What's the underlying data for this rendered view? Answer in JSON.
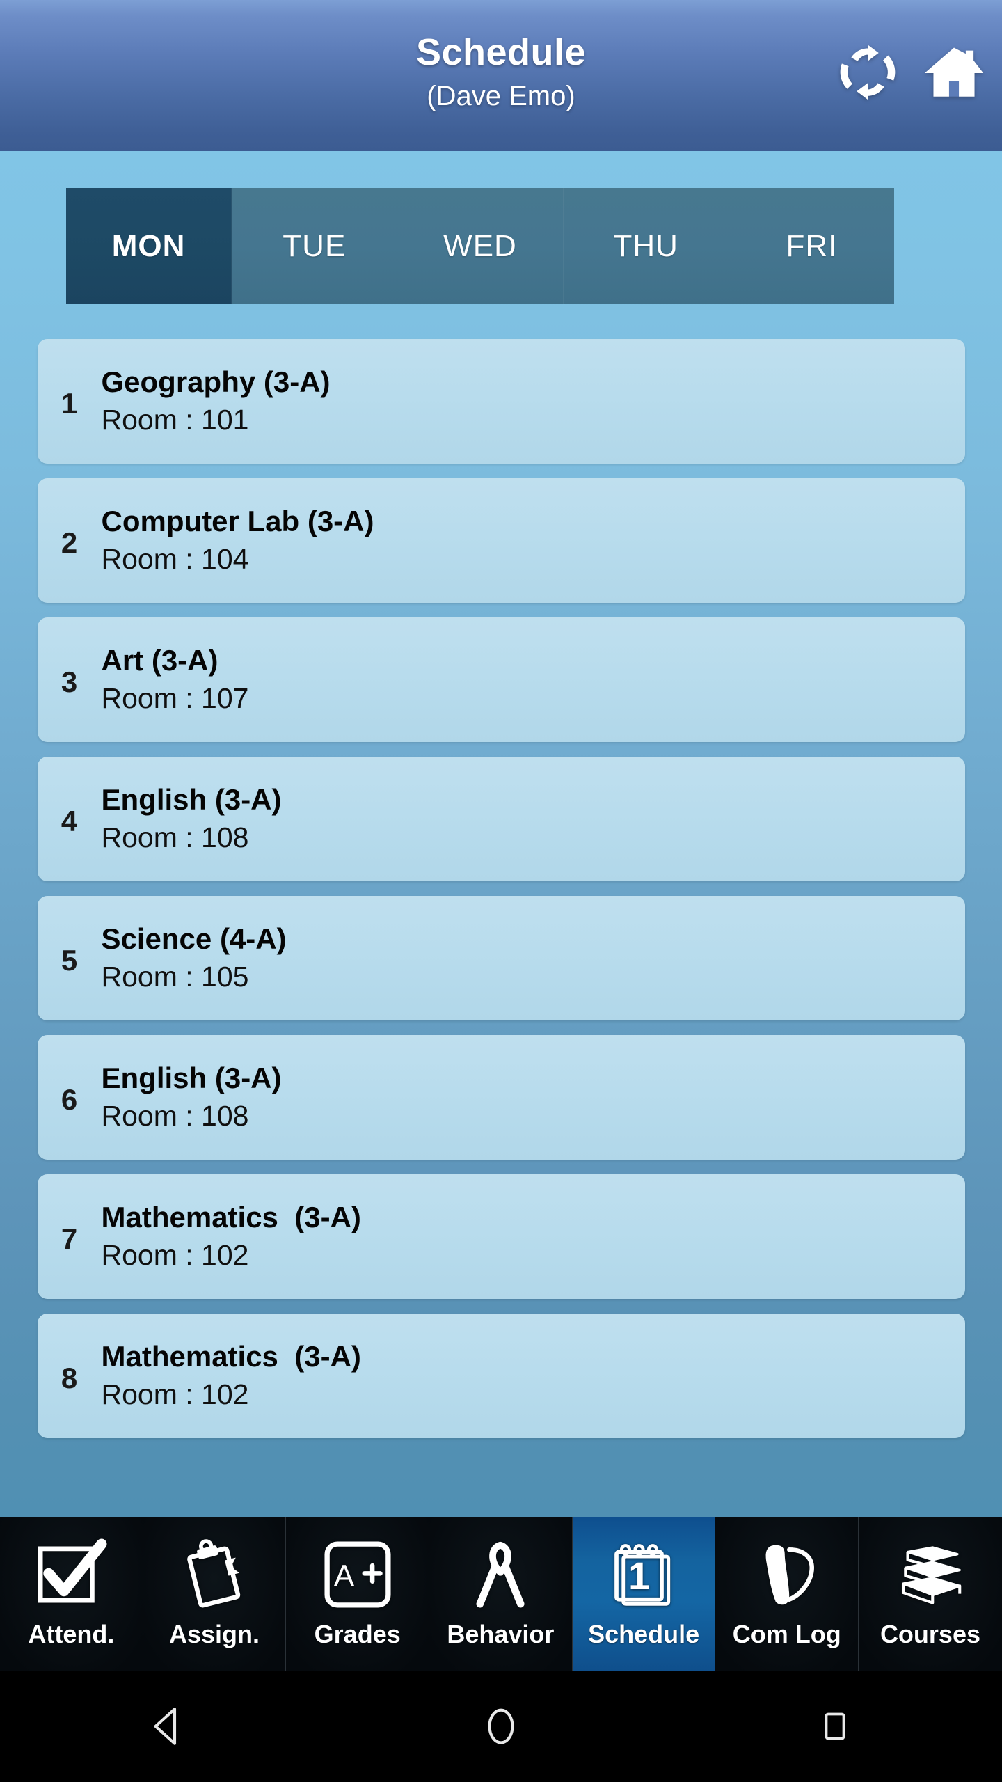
{
  "header": {
    "title": "Schedule",
    "subtitle": "(Dave Emo)",
    "refresh_icon": "refresh-icon",
    "home_icon": "home-icon"
  },
  "day_tabs": {
    "active": "MON",
    "items": [
      {
        "label": "MON",
        "active": true
      },
      {
        "label": "TUE",
        "active": false
      },
      {
        "label": "WED",
        "active": false
      },
      {
        "label": "THU",
        "active": false
      },
      {
        "label": "FRI",
        "active": false
      }
    ]
  },
  "schedule": {
    "room_prefix": "Room : ",
    "periods": [
      {
        "number": "1",
        "subject": "Geography (3-A)",
        "room": "Room : 101"
      },
      {
        "number": "2",
        "subject": "Computer Lab (3-A)",
        "room": "Room : 104"
      },
      {
        "number": "3",
        "subject": "Art (3-A)",
        "room": "Room : 107"
      },
      {
        "number": "4",
        "subject": "English (3-A)",
        "room": "Room : 108"
      },
      {
        "number": "5",
        "subject": "Science (4-A)",
        "room": "Room : 105"
      },
      {
        "number": "6",
        "subject": "English (3-A)",
        "room": "Room : 108"
      },
      {
        "number": "7",
        "subject": "Mathematics  (3-A)",
        "room": "Room : 102"
      },
      {
        "number": "8",
        "subject": "Mathematics  (3-A)",
        "room": "Room : 102"
      }
    ]
  },
  "bottom_nav": {
    "active": "Schedule",
    "items": [
      {
        "label": "Attend.",
        "icon": "checkbox-check-icon",
        "active": false
      },
      {
        "label": "Assign.",
        "icon": "clipboard-icon",
        "active": false
      },
      {
        "label": "Grades",
        "icon": "grade-a-plus-icon",
        "active": false
      },
      {
        "label": "Behavior",
        "icon": "ribbon-icon",
        "active": false
      },
      {
        "label": "Schedule",
        "icon": "calendar-1-icon",
        "active": true
      },
      {
        "label": "Com Log",
        "icon": "phone-handset-icon",
        "active": false
      },
      {
        "label": "Courses",
        "icon": "books-stack-icon",
        "active": false
      }
    ]
  },
  "system_bar": {
    "back": "back-triangle-icon",
    "home": "home-circle-icon",
    "recents": "recents-square-icon"
  },
  "colors": {
    "header_top": "#7d9fd4",
    "header_bottom": "#3c5c92",
    "body_top": "#81c5e6",
    "body_bottom": "#5090b3",
    "tab_active": "#1f4b68",
    "tab_inactive": "#45768f",
    "card": "#b8dced",
    "nav_active": "#14639f",
    "nav_bg": "#050a0e"
  }
}
